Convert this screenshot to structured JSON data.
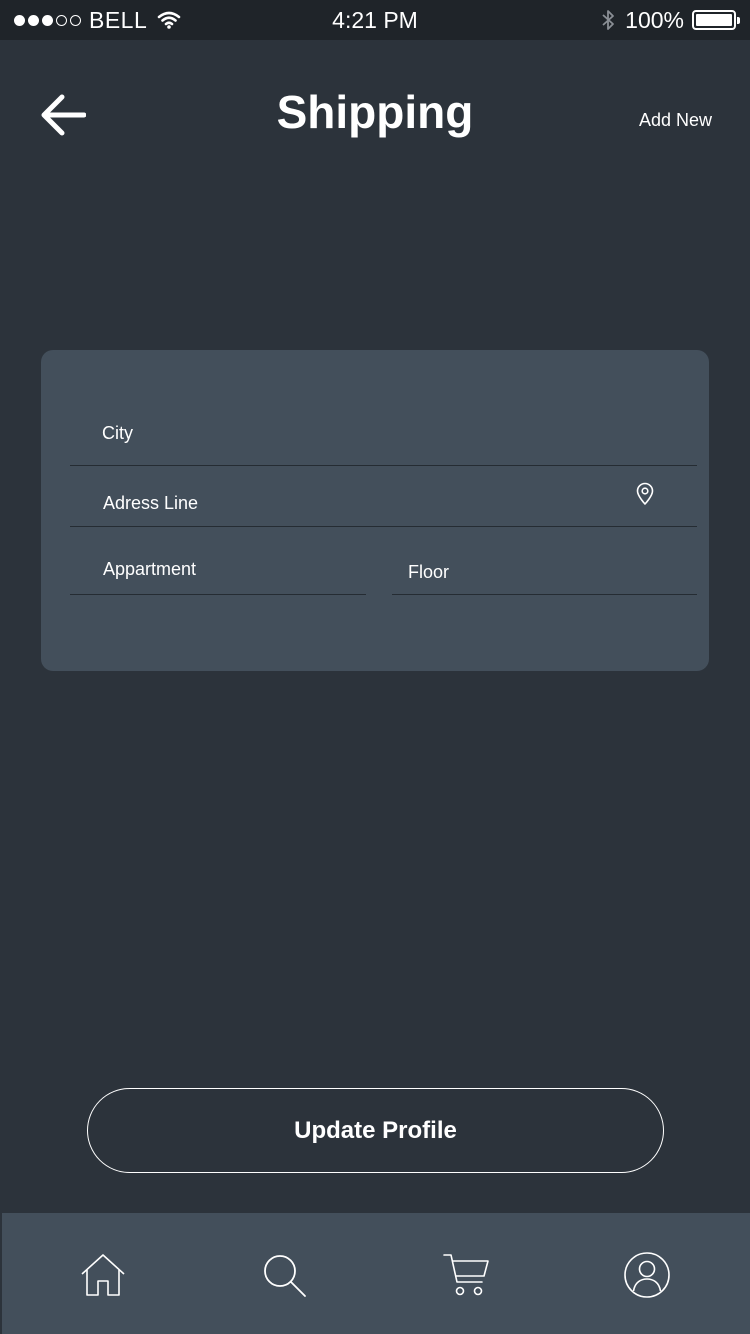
{
  "status_bar": {
    "carrier": "BELL",
    "time": "4:21 PM",
    "battery": "100%",
    "signal_filled": 3,
    "signal_total": 5
  },
  "header": {
    "title": "Shipping",
    "add_new": "Add New",
    "back_icon": "arrow-left-icon"
  },
  "form": {
    "city_placeholder": "City",
    "address_placeholder": "Adress Line",
    "apartment_placeholder": "Appartment",
    "floor_placeholder": "Floor",
    "address_icon": "location-pin-icon"
  },
  "actions": {
    "update_label": "Update Profile"
  },
  "nav": {
    "items": [
      {
        "icon": "home-icon"
      },
      {
        "icon": "search-icon"
      },
      {
        "icon": "cart-icon"
      },
      {
        "icon": "profile-icon"
      }
    ]
  },
  "colors": {
    "background": "#2c333b",
    "status_bar": "#1f2429",
    "card": "#434f5b",
    "nav": "#434f5b",
    "text": "#ffffff"
  }
}
